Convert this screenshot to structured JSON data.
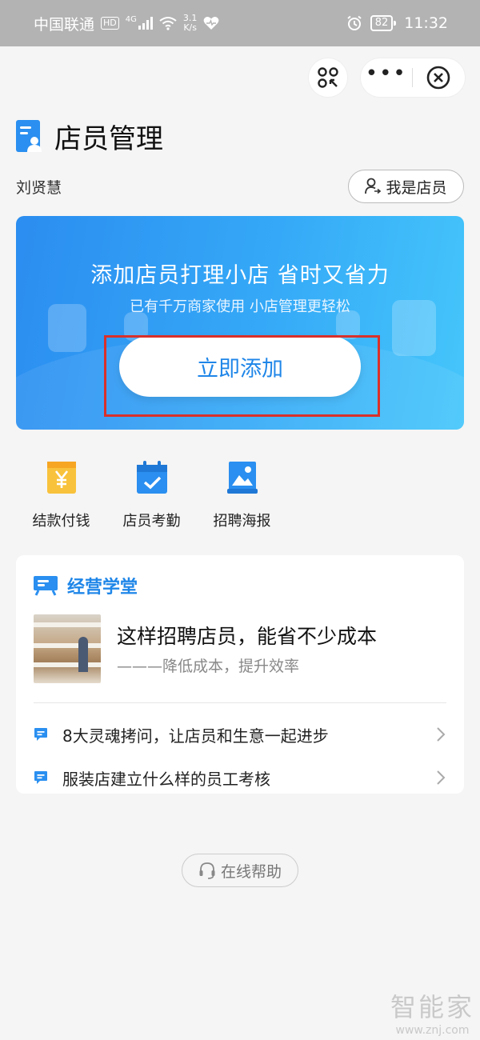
{
  "status_bar": {
    "carrier": "中国联通",
    "hd": "HD",
    "network": "4G",
    "speed_value": "3.1",
    "speed_unit": "K/s",
    "battery": "82",
    "time": "11:32"
  },
  "header": {
    "title": "店员管理",
    "user_name": "刘贤慧",
    "clerk_button": "我是店员"
  },
  "banner": {
    "title": "添加店员打理小店 省时又省力",
    "subtitle": "已有千万商家使用 小店管理更轻松",
    "add_button": "立即添加"
  },
  "actions": [
    {
      "label": "结款付钱",
      "icon": "yen-wallet-icon"
    },
    {
      "label": "店员考勤",
      "icon": "calendar-check-icon"
    },
    {
      "label": "招聘海报",
      "icon": "poster-image-icon"
    }
  ],
  "academy": {
    "title": "经营学堂",
    "featured": {
      "title": "这样招聘店员，能省不少成本",
      "subtitle": "———降低成本，提升效率"
    },
    "links": [
      {
        "text": "8大灵魂拷问，让店员和生意一起进步"
      },
      {
        "text": "服装店建立什么样的员工考核"
      }
    ]
  },
  "help": {
    "label": "在线帮助"
  },
  "watermark": {
    "big": "智能家",
    "small": "www.znj.com"
  },
  "colors": {
    "accent": "#1f86e8",
    "highlight": "#d9302a",
    "banner_start": "#2b8df0",
    "banner_end": "#45c6fb"
  }
}
